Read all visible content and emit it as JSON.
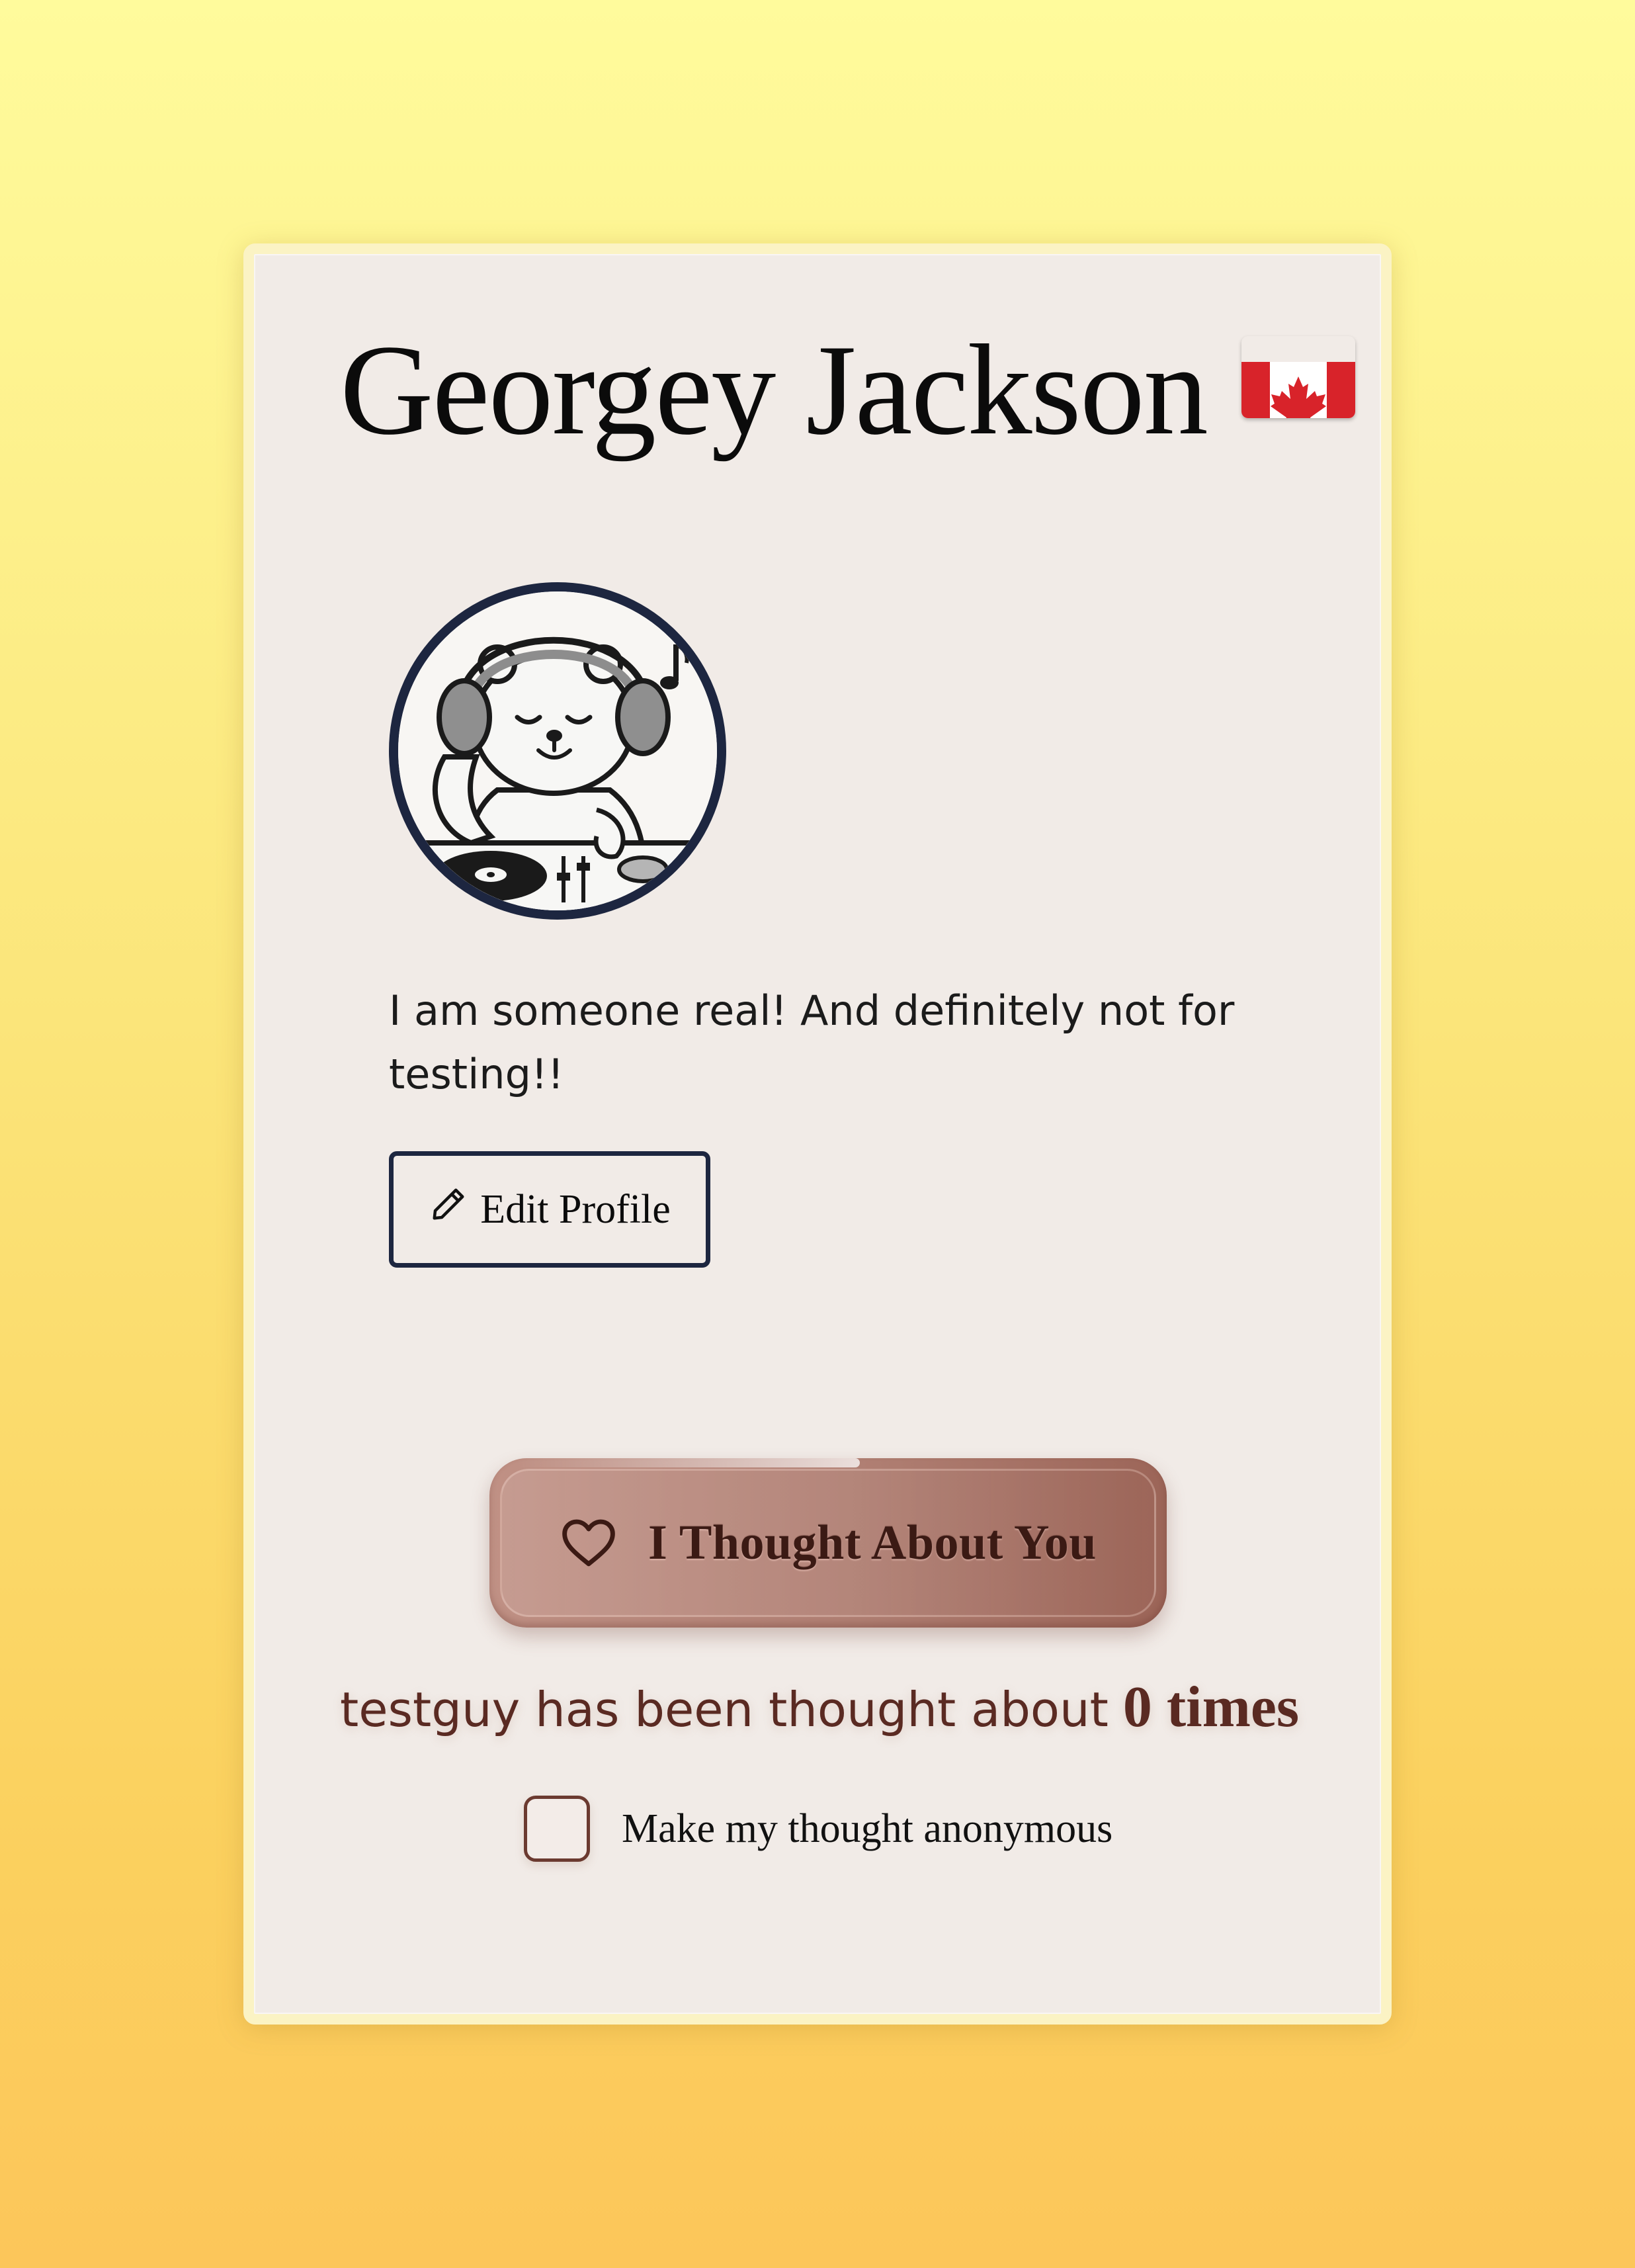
{
  "profile": {
    "name": "Georgey Jackson",
    "flag_icon": "canada-flag-icon",
    "avatar_icon": "polar-bear-dj-avatar",
    "bio": "I am someone real! And definitely not for testing!!"
  },
  "actions": {
    "edit_label": "Edit Profile",
    "edit_icon": "pencil-icon",
    "thought_label": "I Thought About You",
    "thought_icon": "heart-icon"
  },
  "stats": {
    "prefix": "testguy has been thought about",
    "count_text": "0 times"
  },
  "anonymous": {
    "label": "Make my thought anonymous",
    "checked": false
  },
  "colors": {
    "background_top": "#fffb9c",
    "background_bottom": "#fcc65a",
    "card": "#f1ebe7",
    "accent": "#b07f73",
    "accent_text": "#5a2a22",
    "outline": "#1d2640"
  }
}
